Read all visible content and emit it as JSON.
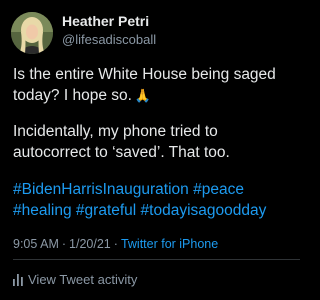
{
  "author": {
    "display_name": "Heather Petri",
    "handle": "@lifesadiscoball",
    "avatar_icon": "profile-photo"
  },
  "tweet": {
    "text_lines_1": [
      "Is the entire White House being saged",
      "today? I hope so."
    ],
    "emoji": "🙏",
    "text_lines_2": [
      "Incidentally, my phone tried to",
      "autocorrect to ‘saved’. That too."
    ],
    "hashtag_lines": [
      "#BidenHarrisInauguration #peace",
      "#healing #grateful #todayisagoodday"
    ]
  },
  "meta": {
    "time": "9:05 AM",
    "date": "1/20/21",
    "separator": "·",
    "source": "Twitter for iPhone"
  },
  "activity": {
    "label": "View Tweet activity",
    "icon": "bar-chart-icon"
  },
  "colors": {
    "background": "#000000",
    "text": "#e7e9ea",
    "secondary": "#8b98a5",
    "link": "#1d9bf0",
    "divider": "#2f3336"
  }
}
